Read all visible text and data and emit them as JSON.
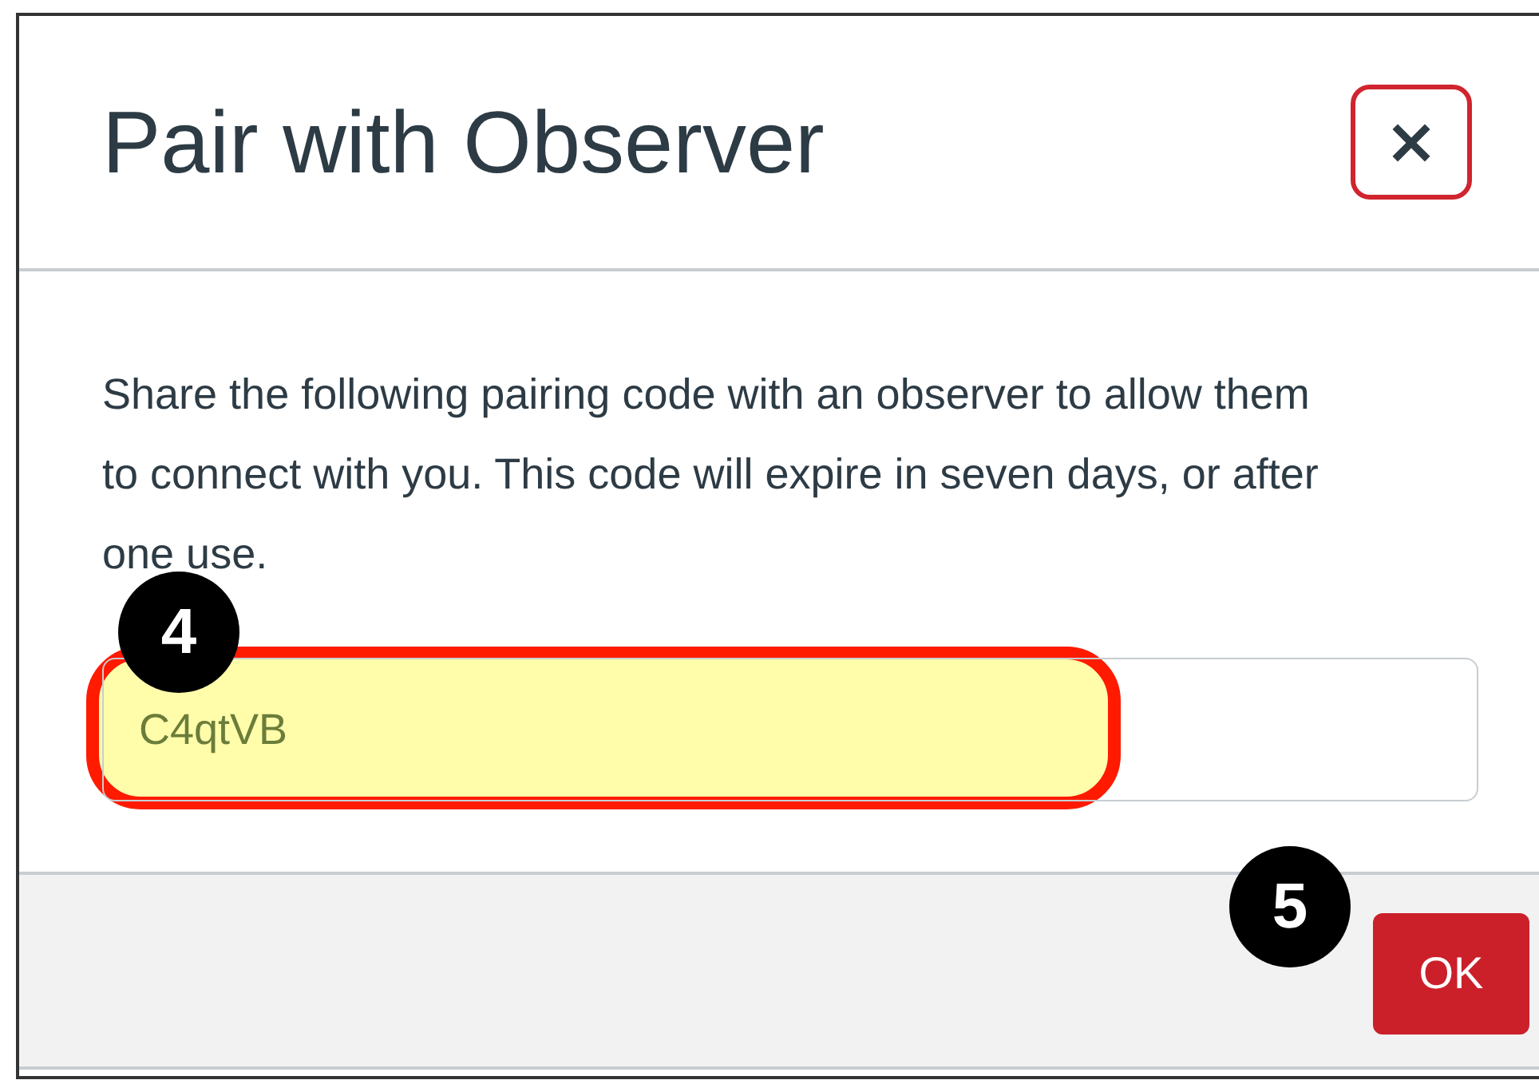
{
  "dialog": {
    "title": "Pair with Observer",
    "close_label": "×",
    "message": "Share the following pairing code with an observer to allow them to connect with you. This code will expire in seven days, or after one use.",
    "code_field": {
      "value": "C4qtVB",
      "highlighted": true
    },
    "buttons": [
      "OK"
    ]
  },
  "callouts": [
    {
      "number": "4"
    },
    {
      "number": "5"
    }
  ]
}
